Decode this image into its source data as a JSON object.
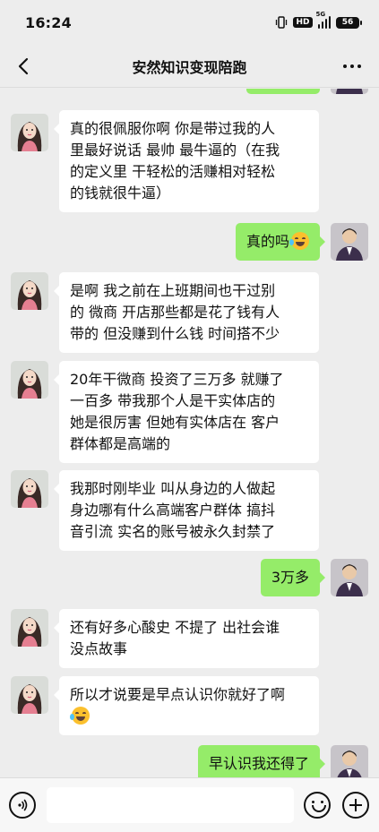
{
  "status_bar": {
    "time": "16:24",
    "hd_label": "HD",
    "network_label": "5G",
    "battery_level": "56"
  },
  "nav": {
    "title": "安然知识变现陪跑",
    "back_icon": "chevron-left-icon",
    "more_icon": "more-dots-icon"
  },
  "messages": [
    {
      "sender": "other",
      "text": "真的很佩服你啊 你是带过我的人里最好说话 最帅 最牛逼的（在我的定义里 干轻松的活赚相对轻松的钱就很牛逼）",
      "lines": [
        "真的很佩服你啊 你是带过我的人",
        "里最好说话 最帅 最牛逼的（在我",
        "的定义里 干轻松的活赚相对轻松",
        "的钱就很牛逼）"
      ]
    },
    {
      "sender": "me",
      "text": "真的吗",
      "emoji": "grinning-sweat-emoji"
    },
    {
      "sender": "other",
      "text": "是啊 我之前在上班期间也干过别的 微商 开店那些都是花了钱有人带的 但没赚到什么钱 时间搭不少",
      "lines": [
        "是啊 我之前在上班期间也干过别",
        "的 微商 开店那些都是花了钱有人",
        "带的 但没赚到什么钱 时间搭不少"
      ]
    },
    {
      "sender": "other",
      "text": "20年干微商 投资了三万多 就赚了一百多 带我那个人是干实体店的 她是很厉害 但她有实体店在 客户群体都是高端的",
      "lines": [
        "20年干微商 投资了三万多 就赚了",
        "一百多 带我那个人是干实体店的",
        "她是很厉害 但她有实体店在 客户",
        "群体都是高端的"
      ]
    },
    {
      "sender": "other",
      "text": "我那时刚毕业 叫从身边的人做起 身边哪有什么高端客户群体 搞抖音引流 实名的账号被永久封禁了",
      "lines": [
        "我那时刚毕业 叫从身边的人做起",
        "身边哪有什么高端客户群体 搞抖",
        "音引流 实名的账号被永久封禁了"
      ]
    },
    {
      "sender": "me",
      "text": "3万多"
    },
    {
      "sender": "other",
      "text": "还有好多心酸史 不提了 出社会谁没点故事",
      "lines": [
        "还有好多心酸史 不提了 出社会谁",
        "没点故事"
      ]
    },
    {
      "sender": "other",
      "text": "所以才说要是早点认识你就好了啊",
      "emoji": "grinning-sweat-emoji"
    },
    {
      "sender": "me",
      "text": "早认识我还得了"
    }
  ],
  "input_bar": {
    "voice_icon": "voice-icon",
    "emoji_icon": "smiley-icon",
    "plus_icon": "plus-icon"
  },
  "colors": {
    "background": "#ededed",
    "my_bubble": "#95ec69",
    "their_bubble": "#ffffff"
  }
}
